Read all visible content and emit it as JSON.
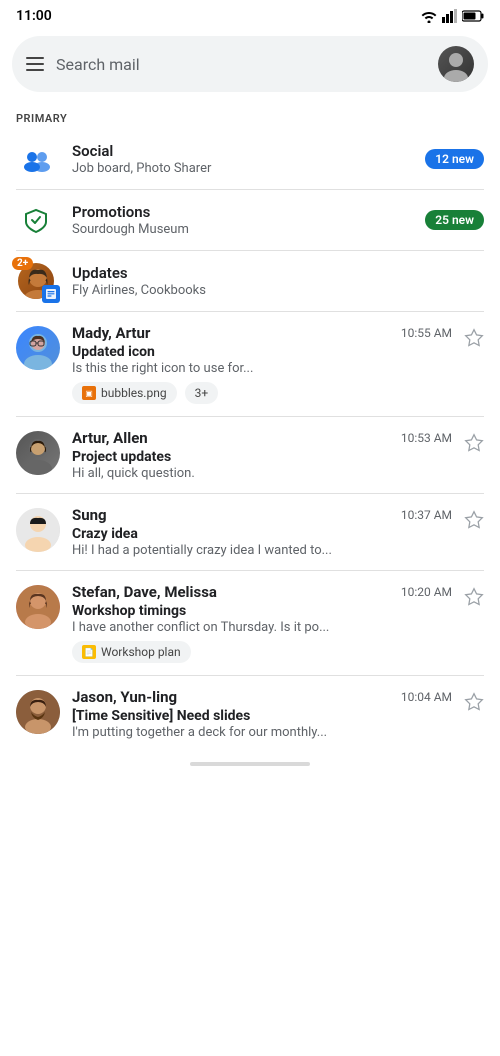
{
  "statusBar": {
    "time": "11:00"
  },
  "searchBar": {
    "placeholder": "Search mail"
  },
  "sectionLabel": "PRIMARY",
  "categories": [
    {
      "id": "social",
      "name": "Social",
      "sub": "Job board, Photo Sharer",
      "badge": "12 new",
      "badgeType": "blue",
      "icon": "people"
    },
    {
      "id": "promotions",
      "name": "Promotions",
      "sub": "Sourdough Museum",
      "badge": "25 new",
      "badgeType": "green",
      "icon": "tag"
    },
    {
      "id": "updates",
      "name": "Updates",
      "sub": "Fly Airlines, Cookbooks",
      "count": "2+",
      "icon": "info"
    }
  ],
  "emails": [
    {
      "id": 1,
      "sender": "Mady, Artur",
      "subject": "Updated icon",
      "preview": "Is this the right icon to use for...",
      "time": "10:55 AM",
      "attachments": [
        "bubbles.png"
      ],
      "moreCount": "3+",
      "avatarType": "mady"
    },
    {
      "id": 2,
      "sender": "Artur, Allen",
      "subject": "Project updates",
      "preview": "Hi all, quick question.",
      "time": "10:53 AM",
      "avatarType": "artur"
    },
    {
      "id": 3,
      "sender": "Sung",
      "subject": "Crazy idea",
      "preview": "Hi! I had a potentially crazy idea I wanted to...",
      "time": "10:37 AM",
      "avatarType": "sung"
    },
    {
      "id": 4,
      "sender": "Stefan, Dave, Melissa",
      "subject": "Workshop timings",
      "preview": "I have another conflict on Thursday. Is it po...",
      "time": "10:20 AM",
      "attachments": [
        "Workshop plan"
      ],
      "attachmentType": "doc",
      "avatarType": "stefan"
    },
    {
      "id": 5,
      "sender": "Jason, Yun-ling",
      "subject": "[Time Sensitive] Need slides",
      "preview": "I'm putting together a deck for our monthly...",
      "time": "10:04 AM",
      "avatarType": "jason"
    }
  ]
}
